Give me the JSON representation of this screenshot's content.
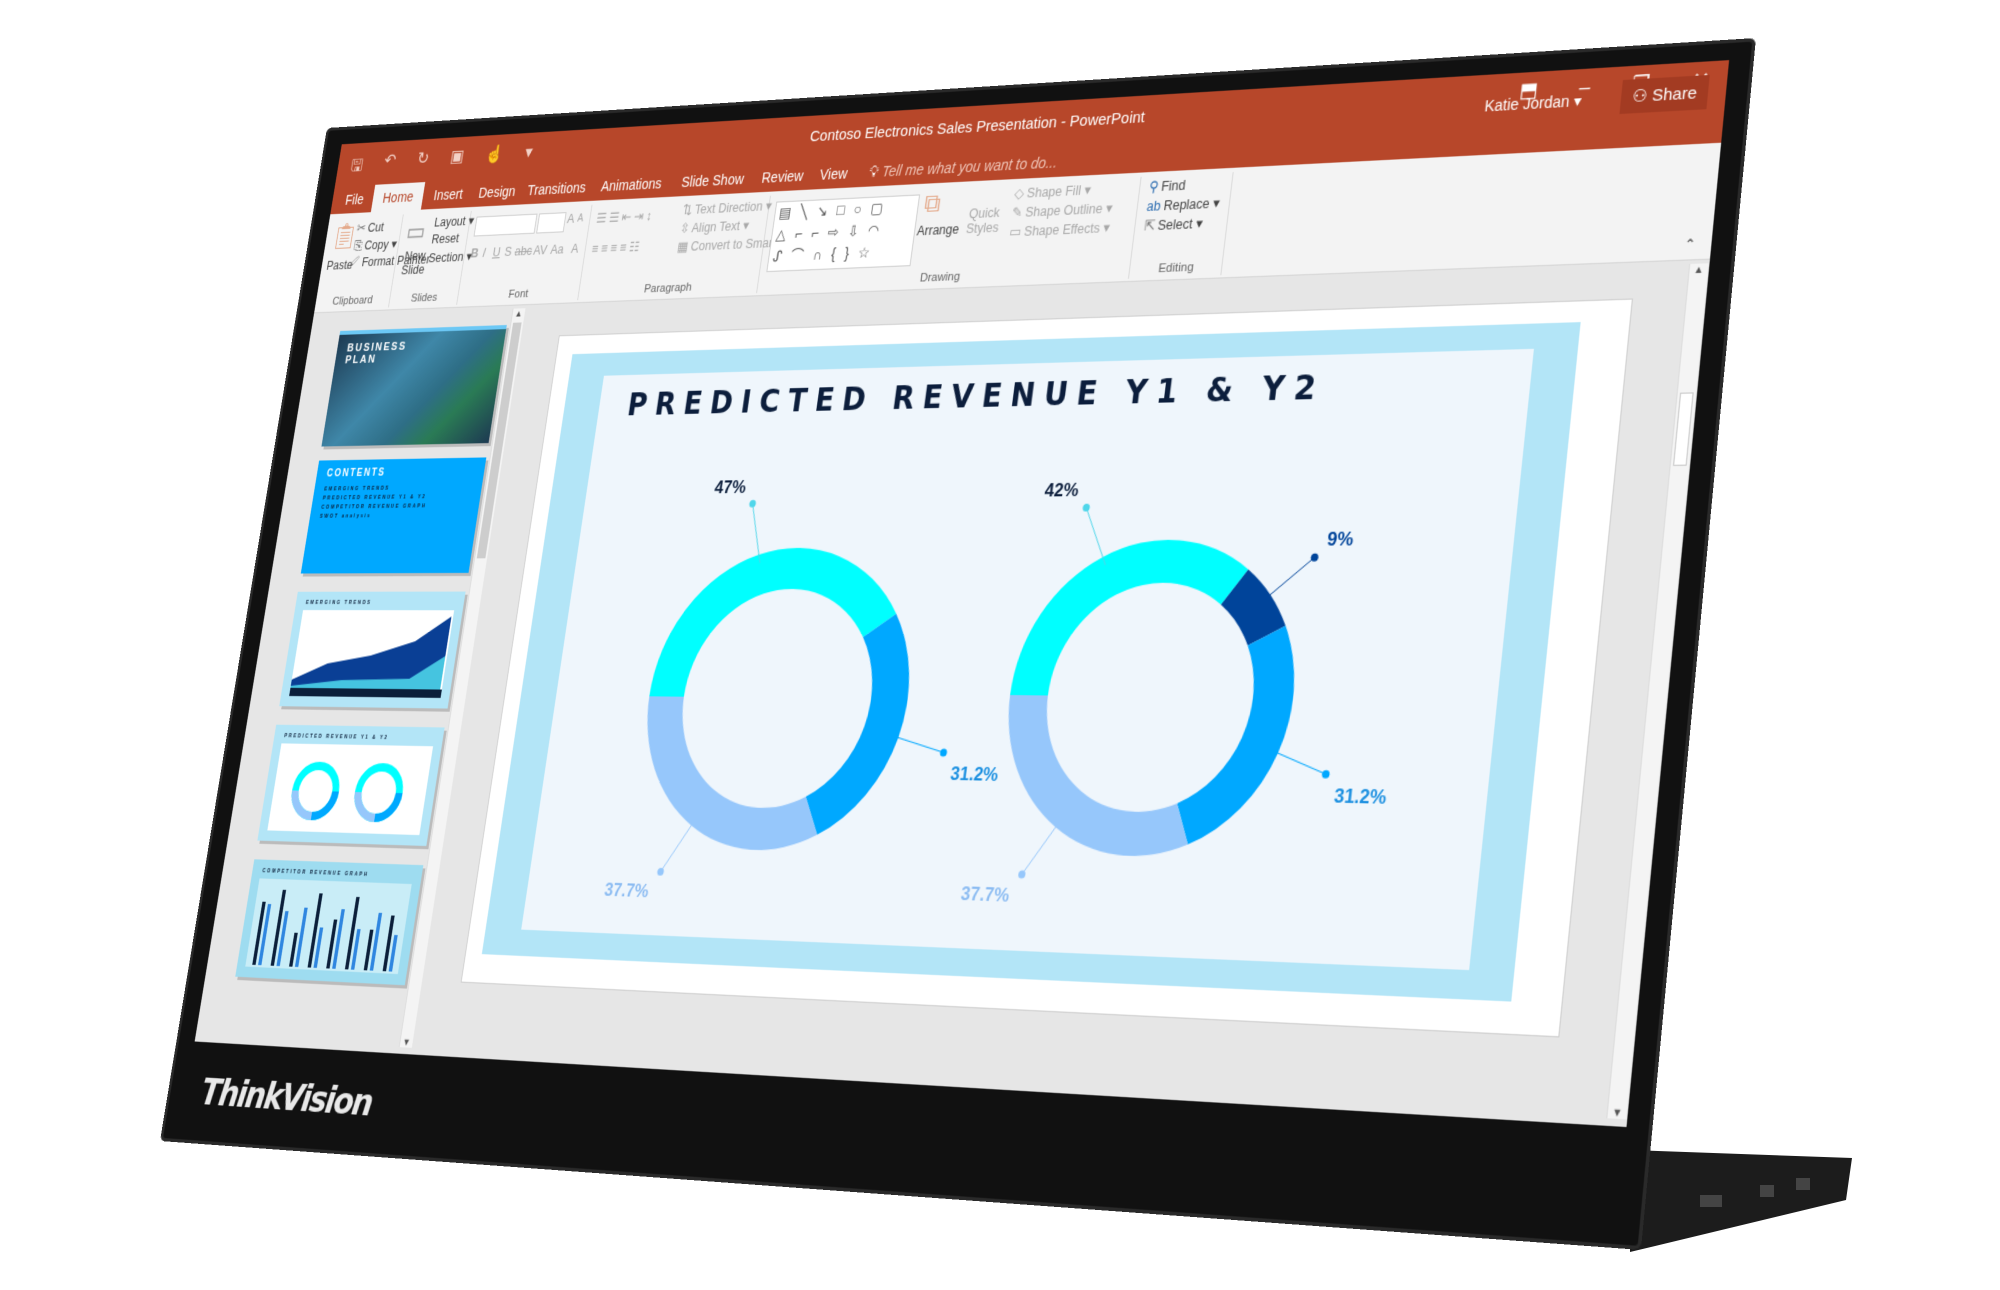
{
  "window": {
    "title": "Contoso Electronics Sales Presentation - PowerPoint",
    "user": "Katie Jordan",
    "share_label": "Share",
    "accent_color": "#b7472a"
  },
  "quick_access": [
    "save-icon",
    "undo-icon",
    "redo-icon",
    "present-icon",
    "touch-mode-icon",
    "customize-icon"
  ],
  "tabs": [
    "File",
    "Home",
    "Insert",
    "Design",
    "Transitions",
    "Animations",
    "Slide Show",
    "Review",
    "View"
  ],
  "active_tab": "Home",
  "tell_me_placeholder": "Tell me what you want to do...",
  "ribbon": {
    "clipboard": {
      "label": "Clipboard",
      "paste": "Paste",
      "cut": "Cut",
      "copy": "Copy",
      "format_painter": "Format Painter"
    },
    "slides": {
      "label": "Slides",
      "new_slide": "New Slide",
      "layout": "Layout",
      "reset": "Reset",
      "section": "Section"
    },
    "font": {
      "label": "Font",
      "bold": "B",
      "italic": "I",
      "underline": "U",
      "shadow": "S",
      "strike": "abc",
      "spacing": "AV",
      "case": "Aa",
      "grow": "A",
      "shrink": "A",
      "color": "A"
    },
    "paragraph": {
      "label": "Paragraph",
      "text_direction": "Text Direction",
      "align_text": "Align Text",
      "smartart": "Convert to SmartArt"
    },
    "drawing": {
      "label": "Drawing",
      "arrange": "Arrange",
      "quick_styles": "Quick Styles",
      "shape_fill": "Shape Fill",
      "shape_outline": "Shape Outline",
      "shape_effects": "Shape Effects",
      "shapes_gallery": [
        "▤ ╲ ↘ □ ○ ▢",
        "△ ⌐ ⌐ ⇨ ⇩ ◠",
        "ᔑ ⌒ ∩ { } ☆"
      ]
    },
    "editing": {
      "label": "Editing",
      "find": "Find",
      "replace": "Replace",
      "select": "Select"
    }
  },
  "thumbnails": [
    {
      "title": "BUSINESS PLAN"
    },
    {
      "title": "CONTENTS",
      "items": [
        "EMERGING TRENDS",
        "PREDICTED REVENUE Y1 & Y2",
        "COMPETITOR REVENUE GRAPH",
        "SWOT analysis"
      ]
    },
    {
      "title": "EMERGING TRENDS"
    },
    {
      "title": "PREDICTED REVENUE Y1 & Y2"
    },
    {
      "title": "COMPETITOR REVENUE GRAPH"
    }
  ],
  "slide": {
    "title": "PREDICTED REVENUE Y1 & Y2"
  },
  "brand": {
    "logo": "ThinkVision"
  },
  "chart_data": [
    {
      "type": "pie",
      "style": "donut",
      "title": "PREDICTED REVENUE Y1 & Y2",
      "values": [
        47,
        31.2,
        37.7
      ],
      "labels": [
        "47%",
        "31.2%",
        "37.7%"
      ],
      "colors": [
        "#00ffff",
        "#00a8ff",
        "#96c7fb"
      ],
      "label_colors": [
        "#0c1e3c",
        "#1a8fe0",
        "#8cbcf2"
      ]
    },
    {
      "type": "pie",
      "style": "donut",
      "title": "PREDICTED REVENUE Y1 & Y2",
      "values": [
        42,
        9,
        31.2,
        37.7
      ],
      "labels": [
        "42%",
        "9%",
        "31.2%",
        "37.7%"
      ],
      "colors": [
        "#00ffff",
        "#00449a",
        "#00a8ff",
        "#96c7fb"
      ],
      "label_colors": [
        "#0c1e3c",
        "#00449a",
        "#1a8fe0",
        "#8cbcf2"
      ]
    }
  ]
}
